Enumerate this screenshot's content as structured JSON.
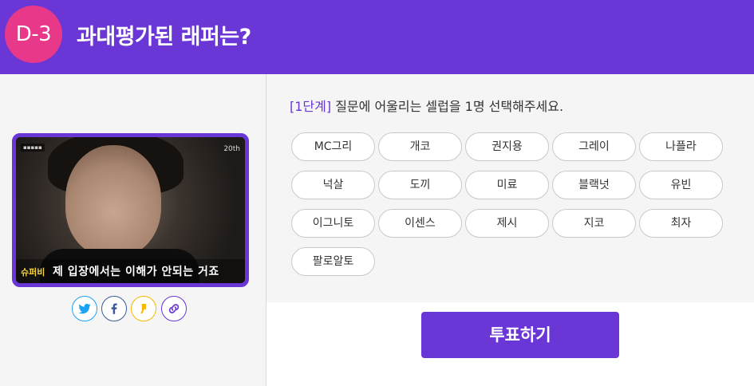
{
  "header": {
    "dday": "D-3",
    "title": "과대평가된 래퍼는?",
    "accent_color": "#6a36d6",
    "badge_color": "#e8388a"
  },
  "media": {
    "caption_name": "슈퍼비",
    "caption_text": "제 입장에서는 이해가 안되는 거죠",
    "badge": "20th"
  },
  "share": [
    {
      "icon": "twitter-icon",
      "color": "#1da1f2"
    },
    {
      "icon": "facebook-icon",
      "color": "#3b5998"
    },
    {
      "icon": "kakaostory-icon",
      "color": "#f6b800"
    },
    {
      "icon": "link-icon",
      "color": "#6a36d6"
    }
  ],
  "instruction": {
    "step": "[1단계]",
    "text": " 질문에 어울리는 셀럽을 1명 선택해주세요."
  },
  "options": [
    "MC그리",
    "개코",
    "권지용",
    "그레이",
    "나플라",
    "넉살",
    "도끼",
    "미료",
    "블랙넛",
    "유빈",
    "이그니토",
    "이센스",
    "제시",
    "지코",
    "최자",
    "팔로알토"
  ],
  "vote_label": "투표하기"
}
